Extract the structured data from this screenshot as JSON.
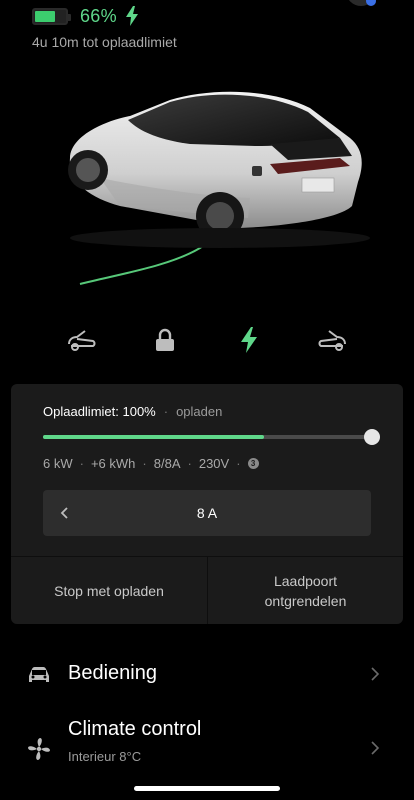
{
  "status": {
    "battery_percent": 66,
    "battery_text": "66%",
    "time_to_limit": "4u 10m tot oplaadlimiet"
  },
  "icons": {
    "battery": "battery-icon",
    "charging": "lightning-bolt-icon",
    "frunk": "frunk-icon",
    "lock": "lock-icon",
    "charge_port": "charge-port-icon",
    "trunk": "trunk-icon",
    "car": "car-icon",
    "fan": "fan-icon",
    "chevron": "chevron-right-icon",
    "amp_decrease": "chevron-left-icon",
    "info": "info-badge-icon"
  },
  "charging": {
    "limit_label": "Oplaadlimiet: 100%",
    "state": "opladen",
    "limit_percent": 100,
    "slider_fraction": 0.67,
    "stats": [
      "6 kW",
      "+6 kWh",
      "8/8A",
      "230V"
    ],
    "info_badge": "3",
    "amps": "8 A",
    "stop_button": "Stop met opladen",
    "port_button_line1": "Laadpoort",
    "port_button_line2": "ontgrendelen"
  },
  "menu": {
    "controls": {
      "title": "Bediening"
    },
    "climate": {
      "title": "Climate control",
      "subtitle": "Interieur 8°C"
    }
  },
  "colors": {
    "accent_green": "#5fd78a",
    "background": "#000000",
    "card": "#1b1b1b"
  }
}
